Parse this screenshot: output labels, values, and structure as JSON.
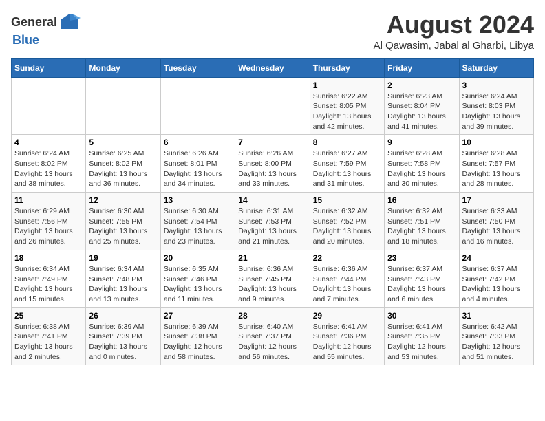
{
  "header": {
    "logo_general": "General",
    "logo_blue": "Blue",
    "main_title": "August 2024",
    "subtitle": "Al Qawasim, Jabal al Gharbi, Libya"
  },
  "weekdays": [
    "Sunday",
    "Monday",
    "Tuesday",
    "Wednesday",
    "Thursday",
    "Friday",
    "Saturday"
  ],
  "weeks": [
    [
      {
        "day": "",
        "info": ""
      },
      {
        "day": "",
        "info": ""
      },
      {
        "day": "",
        "info": ""
      },
      {
        "day": "",
        "info": ""
      },
      {
        "day": "1",
        "info": "Sunrise: 6:22 AM\nSunset: 8:05 PM\nDaylight: 13 hours\nand 42 minutes."
      },
      {
        "day": "2",
        "info": "Sunrise: 6:23 AM\nSunset: 8:04 PM\nDaylight: 13 hours\nand 41 minutes."
      },
      {
        "day": "3",
        "info": "Sunrise: 6:24 AM\nSunset: 8:03 PM\nDaylight: 13 hours\nand 39 minutes."
      }
    ],
    [
      {
        "day": "4",
        "info": "Sunrise: 6:24 AM\nSunset: 8:02 PM\nDaylight: 13 hours\nand 38 minutes."
      },
      {
        "day": "5",
        "info": "Sunrise: 6:25 AM\nSunset: 8:02 PM\nDaylight: 13 hours\nand 36 minutes."
      },
      {
        "day": "6",
        "info": "Sunrise: 6:26 AM\nSunset: 8:01 PM\nDaylight: 13 hours\nand 34 minutes."
      },
      {
        "day": "7",
        "info": "Sunrise: 6:26 AM\nSunset: 8:00 PM\nDaylight: 13 hours\nand 33 minutes."
      },
      {
        "day": "8",
        "info": "Sunrise: 6:27 AM\nSunset: 7:59 PM\nDaylight: 13 hours\nand 31 minutes."
      },
      {
        "day": "9",
        "info": "Sunrise: 6:28 AM\nSunset: 7:58 PM\nDaylight: 13 hours\nand 30 minutes."
      },
      {
        "day": "10",
        "info": "Sunrise: 6:28 AM\nSunset: 7:57 PM\nDaylight: 13 hours\nand 28 minutes."
      }
    ],
    [
      {
        "day": "11",
        "info": "Sunrise: 6:29 AM\nSunset: 7:56 PM\nDaylight: 13 hours\nand 26 minutes."
      },
      {
        "day": "12",
        "info": "Sunrise: 6:30 AM\nSunset: 7:55 PM\nDaylight: 13 hours\nand 25 minutes."
      },
      {
        "day": "13",
        "info": "Sunrise: 6:30 AM\nSunset: 7:54 PM\nDaylight: 13 hours\nand 23 minutes."
      },
      {
        "day": "14",
        "info": "Sunrise: 6:31 AM\nSunset: 7:53 PM\nDaylight: 13 hours\nand 21 minutes."
      },
      {
        "day": "15",
        "info": "Sunrise: 6:32 AM\nSunset: 7:52 PM\nDaylight: 13 hours\nand 20 minutes."
      },
      {
        "day": "16",
        "info": "Sunrise: 6:32 AM\nSunset: 7:51 PM\nDaylight: 13 hours\nand 18 minutes."
      },
      {
        "day": "17",
        "info": "Sunrise: 6:33 AM\nSunset: 7:50 PM\nDaylight: 13 hours\nand 16 minutes."
      }
    ],
    [
      {
        "day": "18",
        "info": "Sunrise: 6:34 AM\nSunset: 7:49 PM\nDaylight: 13 hours\nand 15 minutes."
      },
      {
        "day": "19",
        "info": "Sunrise: 6:34 AM\nSunset: 7:48 PM\nDaylight: 13 hours\nand 13 minutes."
      },
      {
        "day": "20",
        "info": "Sunrise: 6:35 AM\nSunset: 7:46 PM\nDaylight: 13 hours\nand 11 minutes."
      },
      {
        "day": "21",
        "info": "Sunrise: 6:36 AM\nSunset: 7:45 PM\nDaylight: 13 hours\nand 9 minutes."
      },
      {
        "day": "22",
        "info": "Sunrise: 6:36 AM\nSunset: 7:44 PM\nDaylight: 13 hours\nand 7 minutes."
      },
      {
        "day": "23",
        "info": "Sunrise: 6:37 AM\nSunset: 7:43 PM\nDaylight: 13 hours\nand 6 minutes."
      },
      {
        "day": "24",
        "info": "Sunrise: 6:37 AM\nSunset: 7:42 PM\nDaylight: 13 hours\nand 4 minutes."
      }
    ],
    [
      {
        "day": "25",
        "info": "Sunrise: 6:38 AM\nSunset: 7:41 PM\nDaylight: 13 hours\nand 2 minutes."
      },
      {
        "day": "26",
        "info": "Sunrise: 6:39 AM\nSunset: 7:39 PM\nDaylight: 13 hours\nand 0 minutes."
      },
      {
        "day": "27",
        "info": "Sunrise: 6:39 AM\nSunset: 7:38 PM\nDaylight: 12 hours\nand 58 minutes."
      },
      {
        "day": "28",
        "info": "Sunrise: 6:40 AM\nSunset: 7:37 PM\nDaylight: 12 hours\nand 56 minutes."
      },
      {
        "day": "29",
        "info": "Sunrise: 6:41 AM\nSunset: 7:36 PM\nDaylight: 12 hours\nand 55 minutes."
      },
      {
        "day": "30",
        "info": "Sunrise: 6:41 AM\nSunset: 7:35 PM\nDaylight: 12 hours\nand 53 minutes."
      },
      {
        "day": "31",
        "info": "Sunrise: 6:42 AM\nSunset: 7:33 PM\nDaylight: 12 hours\nand 51 minutes."
      }
    ]
  ]
}
